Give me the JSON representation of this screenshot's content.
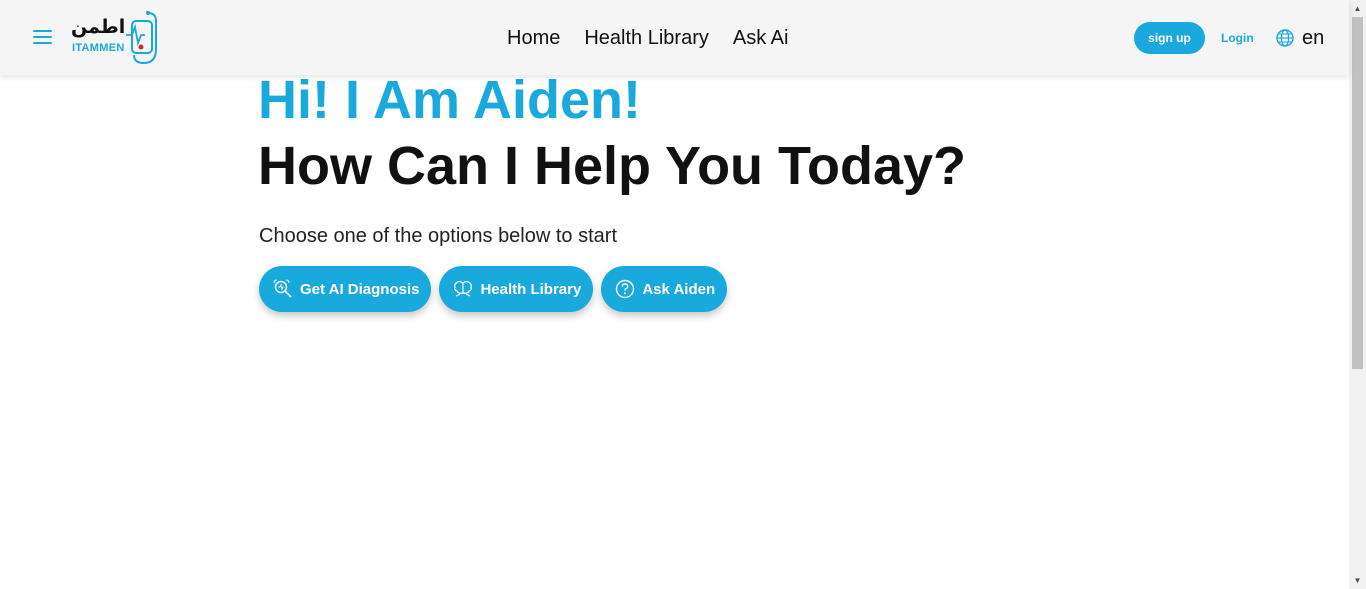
{
  "brand": {
    "arabic_name": "اطمن",
    "latin_name": "ITAMMEN",
    "accent_color": "#1aa9dd"
  },
  "nav": {
    "links": [
      "Home",
      "Health Library",
      "Ask Ai"
    ],
    "signup_label": "sign up",
    "login_label": "Login",
    "language": "en"
  },
  "hero": {
    "greeting": "Hi! I Am Aiden!",
    "title": "How Can I Help You Today?",
    "subtitle": "Choose one of the options below to start"
  },
  "options": [
    {
      "label": "Get AI Diagnosis",
      "icon": "diagnosis-search-icon"
    },
    {
      "label": "Health Library",
      "icon": "library-brain-icon"
    },
    {
      "label": "Ask Aiden",
      "icon": "question-circle-icon"
    }
  ],
  "icons": {
    "menu": "hamburger-menu-icon",
    "language": "globe-icon"
  }
}
